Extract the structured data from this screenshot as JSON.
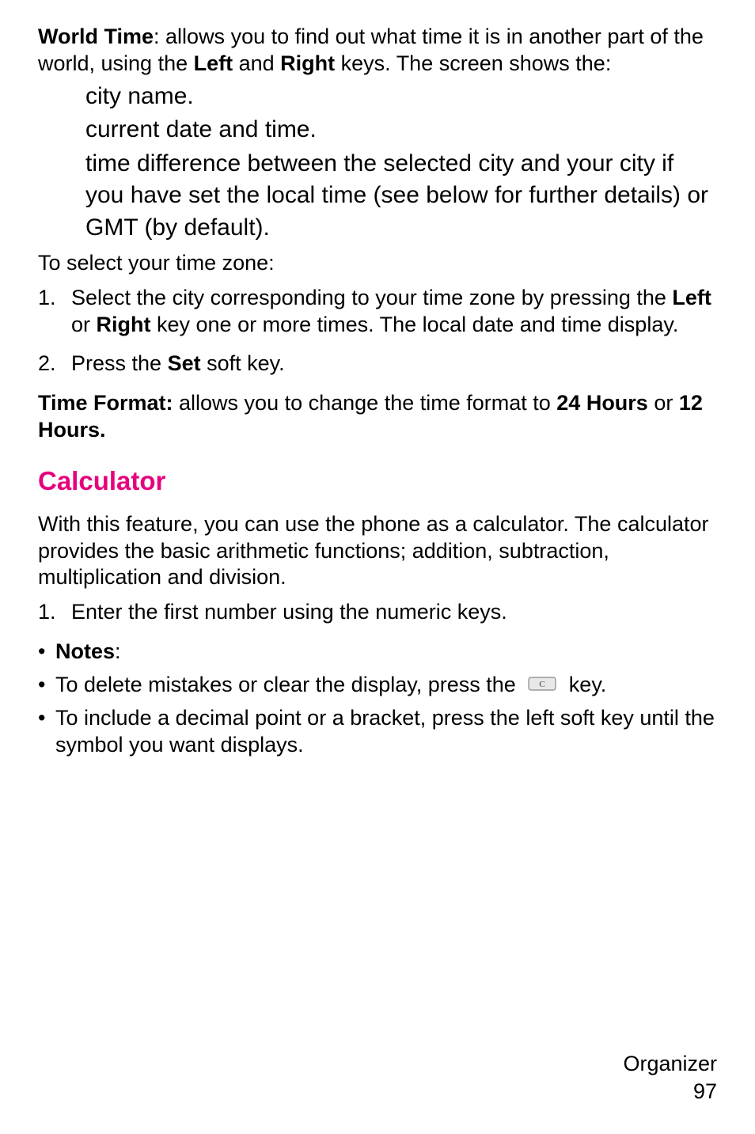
{
  "p1": {
    "b1": "World Time",
    "t1": ": allows you to find out what time it is in another part of the world, using the ",
    "b2": "Left",
    "t2": " and ",
    "b3": "Right",
    "t3": " keys. The screen shows the:"
  },
  "list1": {
    "i1": "city name.",
    "i2": "current date and time.",
    "i3": "time difference between the selected city and your city if you have set the local time (see below for further details) or GMT (by default)."
  },
  "p2": "To select your time zone:",
  "step1": {
    "num": "1.",
    "t1": "Select the city corresponding to your time zone by pressing the ",
    "b1": "Left",
    "t2": " or ",
    "b2": "Right",
    "t3": " key one or more times. The local date and time display."
  },
  "step2": {
    "num": "2.",
    "t1": "Press the ",
    "b1": "Set",
    "t2": " soft key."
  },
  "p3": {
    "b1": "Time Format:",
    "t1": " allows you to change the time format to ",
    "b2": "24 Hours",
    "t2": " or ",
    "b3": "12 Hours."
  },
  "heading": "Calculator",
  "p4": "With this feature, you can use the phone as a calculator. The calculator provides the basic arithmetic functions; addition, subtraction, multiplication and division.",
  "step3": {
    "num": "1.",
    "t1": "Enter the first number using the numeric keys."
  },
  "notes": {
    "dot": "•",
    "b1": "Notes",
    "t1": ":"
  },
  "note1": {
    "dot": "•",
    "t1": "To delete mistakes or clear the display, press the ",
    "t2": " key."
  },
  "note2": {
    "dot": "•",
    "t1": "To include a decimal point or a bracket, press the left soft key until the symbol you want displays."
  },
  "footer": {
    "l1": "Organizer",
    "l2": "97"
  }
}
